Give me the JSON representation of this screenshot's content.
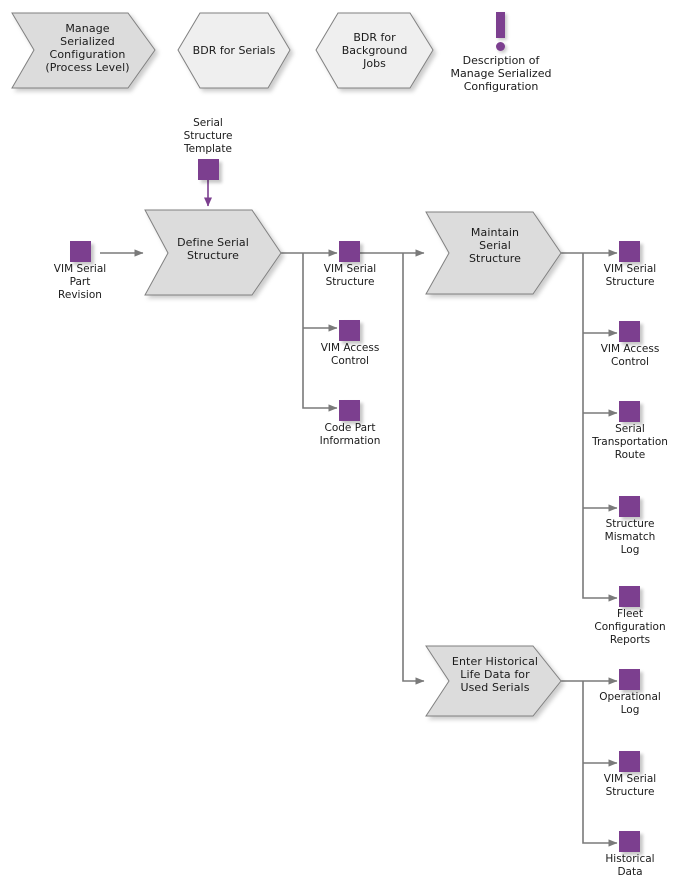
{
  "diagram": {
    "title": "Manage Serialized Configuration process flow",
    "colors": {
      "data_object": "#7c3f8f",
      "process_fill": "#dcdcdc",
      "hexagon_fill": "#efefef",
      "shape_stroke": "#808080",
      "connector": "#808080",
      "text": "#1a1a1a",
      "background": "#ffffff"
    }
  },
  "header": {
    "process_chevron": {
      "label": "Manage\nSerialized\nConfiguration\n(Process Level)",
      "lines": [
        "Manage",
        "Serialized",
        "Configuration",
        "(Process Level)"
      ]
    },
    "hexagons": [
      {
        "label": "BDR for Serials",
        "lines": [
          "BDR for Serials"
        ]
      },
      {
        "label": "BDR for\nBackground\nJobs",
        "lines": [
          "BDR for",
          "Background",
          "Jobs"
        ]
      }
    ],
    "description_marker": {
      "icon": "exclamation-icon",
      "label": "Description of\nManage Serialized\nConfiguration",
      "lines": [
        "Description of",
        "Manage Serialized",
        "Configuration"
      ]
    }
  },
  "processes": [
    {
      "id": "define-serial-structure",
      "label": "Define Serial\nStructure",
      "lines": [
        "Define Serial",
        "Structure"
      ]
    },
    {
      "id": "maintain-serial-structure",
      "label": "Maintain\nSerial\nStructure",
      "lines": [
        "Maintain",
        "Serial",
        "Structure"
      ]
    },
    {
      "id": "enter-historical-life-data",
      "label": "Enter Historical\nLife Data for\nUsed Serials",
      "lines": [
        "Enter Historical",
        "Life Data for",
        "Used Serials"
      ]
    }
  ],
  "data_objects": {
    "template_input": {
      "label": "Serial\nStructure\nTemplate"
    },
    "left_input": {
      "label": "VIM Serial\nPart\nRevision"
    },
    "define_outputs": [
      {
        "label": "VIM Serial\nStructure"
      },
      {
        "label": "VIM Access\nControl"
      },
      {
        "label": "Code Part\nInformation"
      }
    ],
    "maintain_outputs": [
      {
        "label": "VIM Serial\nStructure"
      },
      {
        "label": "VIM Access\nControl"
      },
      {
        "label": "Serial\nTransportation\nRoute"
      },
      {
        "label": "Structure\nMismatch\nLog"
      },
      {
        "label": "Fleet\nConfiguration\nReports"
      }
    ],
    "historical_outputs": [
      {
        "label": "Operational\nLog"
      },
      {
        "label": "VIM Serial\nStructure"
      },
      {
        "label": "Historical\nData"
      }
    ]
  }
}
